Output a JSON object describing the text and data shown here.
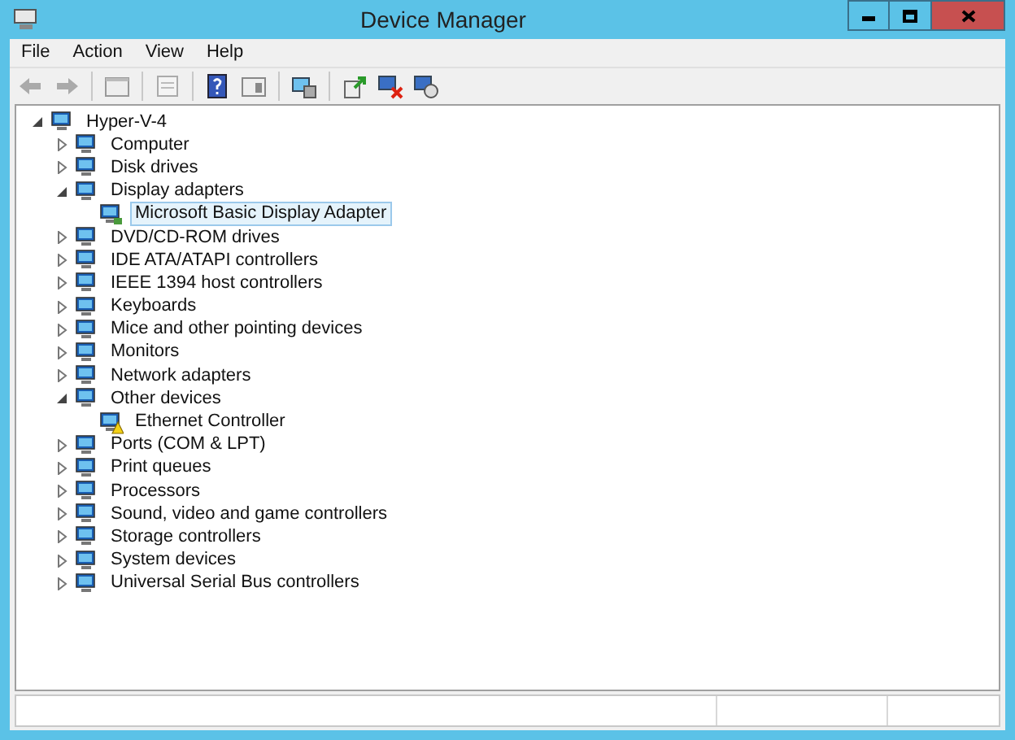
{
  "window": {
    "title": "Device Manager"
  },
  "menu": [
    "File",
    "Action",
    "View",
    "Help"
  ],
  "tree": {
    "label": "Hyper-V-4",
    "expanded": true,
    "selected": false,
    "children": [
      {
        "label": "Computer",
        "expanded": false,
        "selected": false
      },
      {
        "label": "Disk drives",
        "expanded": false,
        "selected": false
      },
      {
        "label": "Display adapters",
        "expanded": true,
        "selected": false,
        "children": [
          {
            "label": "Microsoft Basic Display Adapter",
            "selected": true,
            "warning": false
          }
        ]
      },
      {
        "label": "DVD/CD-ROM drives",
        "expanded": false,
        "selected": false
      },
      {
        "label": "IDE ATA/ATAPI controllers",
        "expanded": false,
        "selected": false
      },
      {
        "label": "IEEE 1394 host controllers",
        "expanded": false,
        "selected": false
      },
      {
        "label": "Keyboards",
        "expanded": false,
        "selected": false
      },
      {
        "label": "Mice and other pointing devices",
        "expanded": false,
        "selected": false
      },
      {
        "label": "Monitors",
        "expanded": false,
        "selected": false
      },
      {
        "label": "Network adapters",
        "expanded": false,
        "selected": false
      },
      {
        "label": "Other devices",
        "expanded": true,
        "selected": false,
        "children": [
          {
            "label": "Ethernet Controller",
            "selected": false,
            "warning": true
          }
        ]
      },
      {
        "label": "Ports (COM & LPT)",
        "expanded": false,
        "selected": false
      },
      {
        "label": "Print queues",
        "expanded": false,
        "selected": false
      },
      {
        "label": "Processors",
        "expanded": false,
        "selected": false
      },
      {
        "label": "Sound, video and game controllers",
        "expanded": false,
        "selected": false
      },
      {
        "label": "Storage controllers",
        "expanded": false,
        "selected": false
      },
      {
        "label": "System devices",
        "expanded": false,
        "selected": false
      },
      {
        "label": "Universal Serial Bus controllers",
        "expanded": false,
        "selected": false
      }
    ]
  }
}
